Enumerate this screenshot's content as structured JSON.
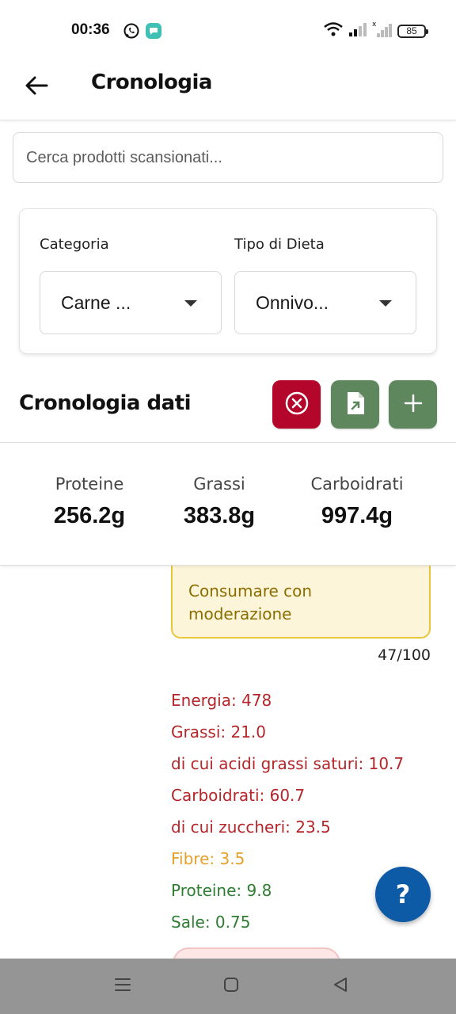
{
  "status_bar": {
    "time": "00:36",
    "battery": "85"
  },
  "header": {
    "title": "Cronologia"
  },
  "search": {
    "placeholder": "Cerca prodotti scansionati..."
  },
  "filters": {
    "category_label": "Categoria",
    "category_value": "Carne ...",
    "diet_label": "Tipo di Dieta",
    "diet_value": "Onnivo..."
  },
  "section": {
    "title": "Cronologia dati"
  },
  "totals": {
    "protein_label": "Proteine",
    "protein_value": "256.2g",
    "fat_label": "Grassi",
    "fat_value": "383.8g",
    "carbs_label": "Carboidrati",
    "carbs_value": "997.4g"
  },
  "product": {
    "warning": "Consumare con moderazione",
    "score": "47/100",
    "nutrients": [
      "Energia: 478",
      "Grassi: 21.0",
      "di cui acidi grassi saturi: 10.7",
      "Carboidrati: 60.7",
      "di cui zuccheri: 23.5",
      "Fibre: 3.5",
      "Proteine: 9.8",
      "Sale: 0.75"
    ]
  },
  "fab": {
    "label": "?"
  },
  "colors": {
    "danger": "#b3062a",
    "action_green": "#5e875d",
    "fab_blue": "#0d5aa7",
    "nutrient_red": "#b3262a",
    "nutrient_orange": "#e5a02b",
    "nutrient_green": "#2e7d32",
    "warning_bg": "#fdf5d9",
    "warning_border": "#e9c63a"
  },
  "icons": {
    "back": "arrow-left-icon",
    "clear": "close-circle-icon",
    "export": "file-export-icon",
    "add": "plus-icon",
    "nav_menu": "menu-icon",
    "nav_home": "home-square-icon",
    "nav_back": "triangle-back-icon"
  }
}
